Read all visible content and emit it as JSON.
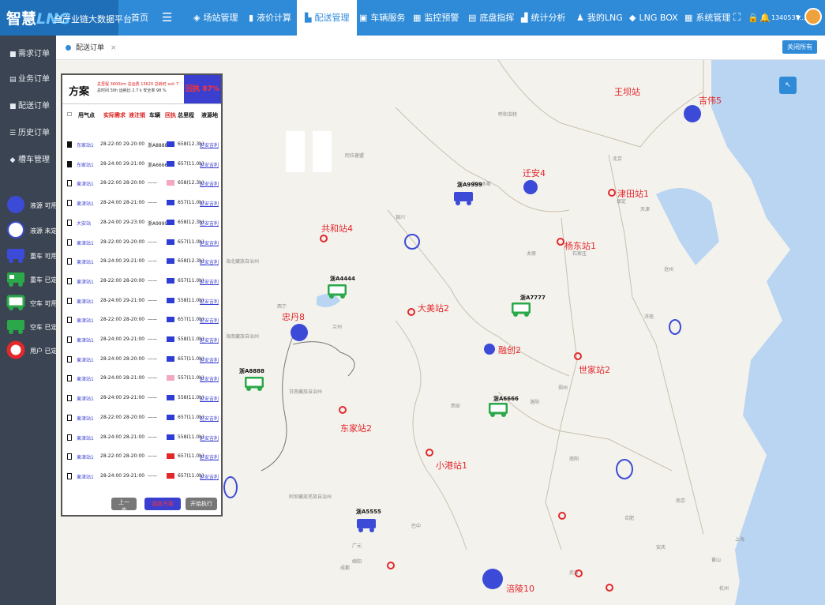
{
  "header": {
    "brand_main": "智慧",
    "brand_lng": "LNG",
    "brand_sub": "全产业链大数据平台",
    "nav": [
      {
        "label": "首页",
        "icon": "home"
      },
      {
        "label": "☰",
        "icon": "menu-icon"
      },
      {
        "label": "场站管理",
        "icon": "layers-icon"
      },
      {
        "label": "液价计算",
        "icon": "doc-icon"
      },
      {
        "label": "配送管理",
        "icon": "truck-icon",
        "active": true
      },
      {
        "label": "车辆服务",
        "icon": "car-icon"
      },
      {
        "label": "监控预警",
        "icon": "monitor-icon"
      },
      {
        "label": "底盘指挥",
        "icon": "server-icon"
      },
      {
        "label": "统计分析",
        "icon": "bar-chart-icon"
      },
      {
        "label": "我的LNG",
        "icon": "user-icon"
      },
      {
        "label": "LNG BOX",
        "icon": "box-icon"
      },
      {
        "label": "系统管理",
        "icon": "windows-icon"
      }
    ],
    "user_id": "1340537..."
  },
  "sidebar": {
    "items": [
      {
        "label": "需求订单"
      },
      {
        "label": "业务订单"
      },
      {
        "label": "配送订单"
      },
      {
        "label": "历史订单"
      },
      {
        "label": "槽车管理"
      }
    ],
    "legend": [
      {
        "label": "液源 可用",
        "symbol": "blue-filled-circle"
      },
      {
        "label": "液源 未定",
        "symbol": "blue-ring"
      },
      {
        "label": "重车 可用",
        "symbol": "blue-truck"
      },
      {
        "label": "重车 已定",
        "symbol": "green-truck"
      },
      {
        "label": "空车 可用",
        "symbol": "green-outline-truck"
      },
      {
        "label": "空车 已定",
        "symbol": "green-truck-2"
      },
      {
        "label": "用户 已定",
        "symbol": "red-ring"
      }
    ]
  },
  "tabs": {
    "active_tab": "配送订单",
    "close_all": "关闭所有"
  },
  "panel": {
    "title": "方案",
    "stats_line1": "总里程 3600km  总运费 15620  总耗时 xxh 7",
    "stats_line2": "总时间 30h  运耗比 2.7 k  安全率 98 %",
    "status_box": "回执 87%",
    "columns": [
      "用气点",
      "实际需求",
      "液注销",
      "车辆",
      "回执",
      "总里程",
      "液源地"
    ],
    "rows": [
      {
        "point": "东家站1",
        "time": "28-22:00  29-20:00",
        "vehicle": "浙A8888",
        "dist": "658(12.3h)",
        "source": "延安吉利",
        "checked": true,
        "color": "#2e3ed4"
      },
      {
        "point": "东家站1",
        "time": "28-24:00  29-21:00",
        "vehicle": "浙A6666",
        "dist": "657(11.0h)",
        "source": "延安吉利",
        "checked": true,
        "color": "#2e3ed4"
      },
      {
        "point": "東津站1",
        "time": "28-22:00  28-20:00",
        "vehicle": "——",
        "dist": "658(12.3h)",
        "source": "延安吉利",
        "checked": false,
        "color": "#f2a7c3"
      },
      {
        "point": "東津站1",
        "time": "28-24:00  28-21:00",
        "vehicle": "——",
        "dist": "657(11.0h)",
        "source": "延安吉利",
        "checked": false,
        "color": "#2e3ed4"
      },
      {
        "point": "大安站",
        "time": "28-24:00  29-23:00",
        "vehicle": "浙A9999",
        "dist": "658(12.3h)",
        "source": "延安吉利",
        "checked": false,
        "color": "#2e3ed4"
      },
      {
        "point": "東津站1",
        "time": "28-22:00  29-20:00",
        "vehicle": "——",
        "dist": "657(11.0h)",
        "source": "延安吉利",
        "checked": false,
        "color": "#2e3ed4"
      },
      {
        "point": "東津站1",
        "time": "28-24:00  29-21:00",
        "vehicle": "——",
        "dist": "658(12.3h)",
        "source": "延安吉利",
        "checked": false,
        "color": "#2e3ed4"
      },
      {
        "point": "東津站1",
        "time": "28-22:00  28-20:00",
        "vehicle": "——",
        "dist": "657(11.0h)",
        "source": "延安吉利",
        "checked": false,
        "color": "#2e3ed4"
      },
      {
        "point": "東津站1",
        "time": "28-24:00  29-21:00",
        "vehicle": "——",
        "dist": "558(11.0h)",
        "source": "延安吉利",
        "checked": false,
        "color": "#2e3ed4"
      },
      {
        "point": "東津站1",
        "time": "28-22:00  28-20:00",
        "vehicle": "——",
        "dist": "657(11.0h)",
        "source": "延安吉利",
        "checked": false,
        "color": "#2e3ed4"
      },
      {
        "point": "東津站1",
        "time": "28-24:00  29-21:00",
        "vehicle": "——",
        "dist": "558(11.0h)",
        "source": "延安吉利",
        "checked": false,
        "color": "#2e3ed4"
      },
      {
        "point": "東津站1",
        "time": "28-24:00  28-20:00",
        "vehicle": "——",
        "dist": "657(11.0h)",
        "source": "延安吉利",
        "checked": false,
        "color": "#2e3ed4"
      },
      {
        "point": "東津站1",
        "time": "28-24:00  28-21:00",
        "vehicle": "——",
        "dist": "557(11.0h)",
        "source": "延安吉利",
        "checked": false,
        "color": "#f2a7c3"
      },
      {
        "point": "東津站1",
        "time": "28-24:00  29-21:00",
        "vehicle": "——",
        "dist": "558(11.0h)",
        "source": "延安吉利",
        "checked": false,
        "color": "#2e3ed4"
      },
      {
        "point": "東津站1",
        "time": "28-22:00  28-20:00",
        "vehicle": "——",
        "dist": "657(11.0h)",
        "source": "延安吉利",
        "checked": false,
        "color": "#2e3ed4"
      },
      {
        "point": "東津站1",
        "time": "28-24:00  28-21:00",
        "vehicle": "——",
        "dist": "558(11.0h)",
        "source": "延安吉利",
        "checked": false,
        "color": "#2e3ed4"
      },
      {
        "point": "東津站1",
        "time": "28-22:00  28-20:00",
        "vehicle": "——",
        "dist": "657(11.0h)",
        "source": "延安吉利",
        "checked": false,
        "color": "#e3282c"
      },
      {
        "point": "東津站1",
        "time": "28-24:00  29-21:00",
        "vehicle": "——",
        "dist": "657(11.0h)",
        "source": "延安吉利",
        "checked": false,
        "color": "#e3282c"
      }
    ],
    "btn_prev": "上一步",
    "btn_mid": "调度方案",
    "btn_exec": "开始执行"
  },
  "map": {
    "stations": [
      {
        "label": "王坝站"
      },
      {
        "label": "吉伟5"
      },
      {
        "label": "迁安4"
      },
      {
        "label": "津田站1"
      },
      {
        "label": "共和站4"
      },
      {
        "label": "杨东站1"
      },
      {
        "label": "大美站2"
      },
      {
        "label": "忠丹8"
      },
      {
        "label": "融创2"
      },
      {
        "label": "世家站2"
      },
      {
        "label": "东家站2"
      },
      {
        "label": "小港站1"
      },
      {
        "label": "涪陵10"
      }
    ],
    "trucks": [
      {
        "label": "浙A9999"
      },
      {
        "label": "浙A4444"
      },
      {
        "label": "浙A7777"
      },
      {
        "label": "浙A8888"
      },
      {
        "label": "浙A6666"
      },
      {
        "label": "浙A5555"
      }
    ],
    "places": [
      "呼和浩特",
      "北京",
      "天津",
      "太原",
      "石家庄",
      "银川",
      "兰州",
      "西宁",
      "济南",
      "郑州",
      "西安",
      "南京",
      "合肥",
      "武汉",
      "成都",
      "上海",
      "杭州",
      "海北藏族自治州",
      "海南藏族自治州",
      "甘南藏族自治州",
      "阿坝藏族羌族自治州",
      "阿拉善盟",
      "鄂尔多斯",
      "保定",
      "沧州",
      "洛阳",
      "南阳",
      "巴中",
      "广元",
      "绵阳",
      "黄山",
      "安庆"
    ],
    "colors": {
      "station_red": "#e3282c",
      "liquid_blue": "#3b4bd8",
      "truck_green": "#2aa84a"
    }
  }
}
